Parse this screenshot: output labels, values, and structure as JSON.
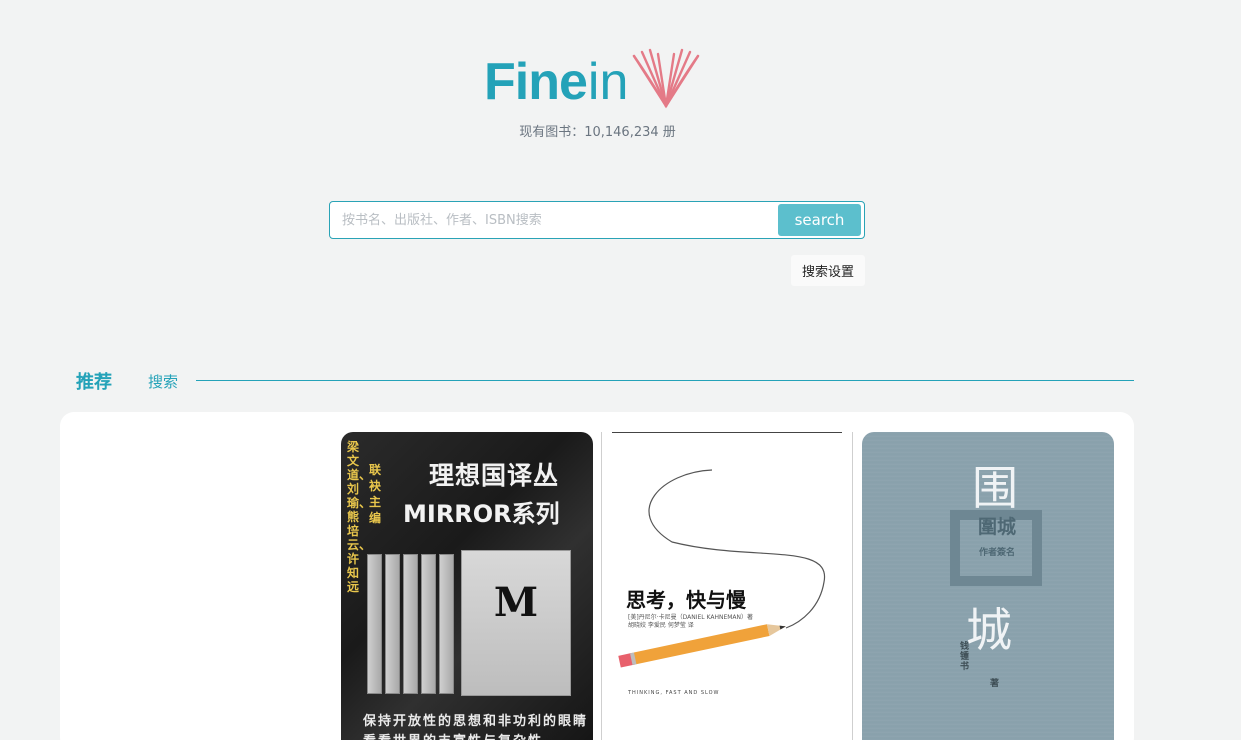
{
  "brand": {
    "logo_fine": "Fine",
    "logo_in": "in",
    "book_count_text": "现有图书：10,146,234 册",
    "accent_color": "#24a2b8",
    "icon_color": "#e47a87"
  },
  "search": {
    "placeholder": "按书名、出版社、作者、ISBN搜索",
    "value": "",
    "button_label": "search",
    "settings_label": "搜索设置"
  },
  "tabs": [
    {
      "label": "推荐",
      "active": true
    },
    {
      "label": "搜索",
      "active": false
    }
  ],
  "books": [
    {
      "title_line1": "理想国译丛",
      "title_line2": "MIRROR系列",
      "editors_line1": "梁文道、刘瑜、熊培云、许知远",
      "editors_line2": "联袂主编",
      "box_letter": "M",
      "tagline": "保持开放性的思想和非功利的眼睛",
      "tagline2": "看看世界的丰富性与复杂性"
    },
    {
      "title": "思考，快与慢",
      "author_line": "[美]丹尼尔·卡尼曼（DANIEL KAHNEMAN）著",
      "translator_line": "胡晓姣 李爱民 何梦莹 译",
      "english_title": "THINKING, FAST AND SLOW"
    },
    {
      "char_top": "围",
      "char_bottom": "城",
      "seal_text": "圍城",
      "seal_sub": "作者簽名",
      "author": "钱锺书",
      "author_suffix": "著"
    }
  ]
}
